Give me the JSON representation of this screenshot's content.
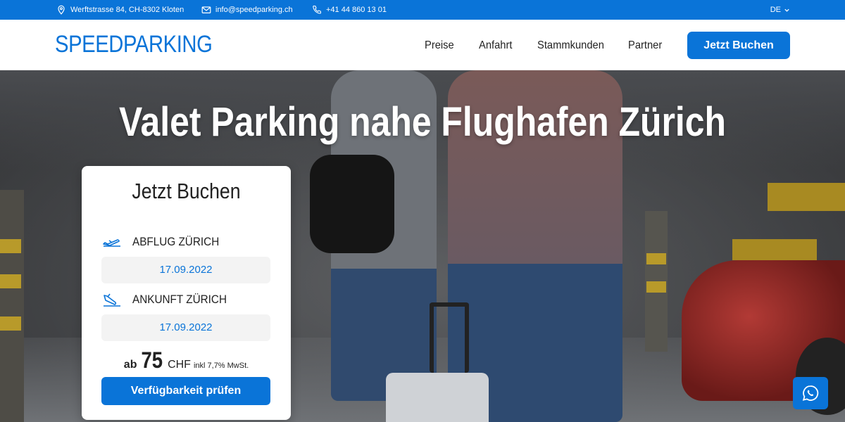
{
  "topbar": {
    "address": "Werftstrasse 84, CH-8302 Kloten",
    "email": "info@speedparking.ch",
    "phone": "+41 44 860 13 01",
    "language": "DE"
  },
  "header": {
    "logo": "SPEEDPARKING",
    "nav": [
      "Preise",
      "Anfahrt",
      "Stammkunden",
      "Partner"
    ],
    "book_label": "Jetzt Buchen"
  },
  "hero": {
    "title": "Valet Parking nahe Flughafen Zürich"
  },
  "booking": {
    "title": "Jetzt Buchen",
    "departure_label": "ABFLUG ZÜRICH",
    "departure_date": "17.09.2022",
    "arrival_label": "ANKUNFT ZÜRICH",
    "arrival_date": "17.09.2022",
    "price_prefix": "ab",
    "price_value": "75",
    "currency": "CHF",
    "vat_note": "inkl 7,7% MwSt.",
    "check_label": "Verfügbarkeit prüfen"
  },
  "colors": {
    "brand": "#0a74d8"
  },
  "icons": {
    "address": "location-pin-icon",
    "email": "envelope-icon",
    "phone": "phone-icon",
    "departure": "plane-takeoff-icon",
    "arrival": "plane-landing-icon",
    "chat": "whatsapp-icon"
  }
}
